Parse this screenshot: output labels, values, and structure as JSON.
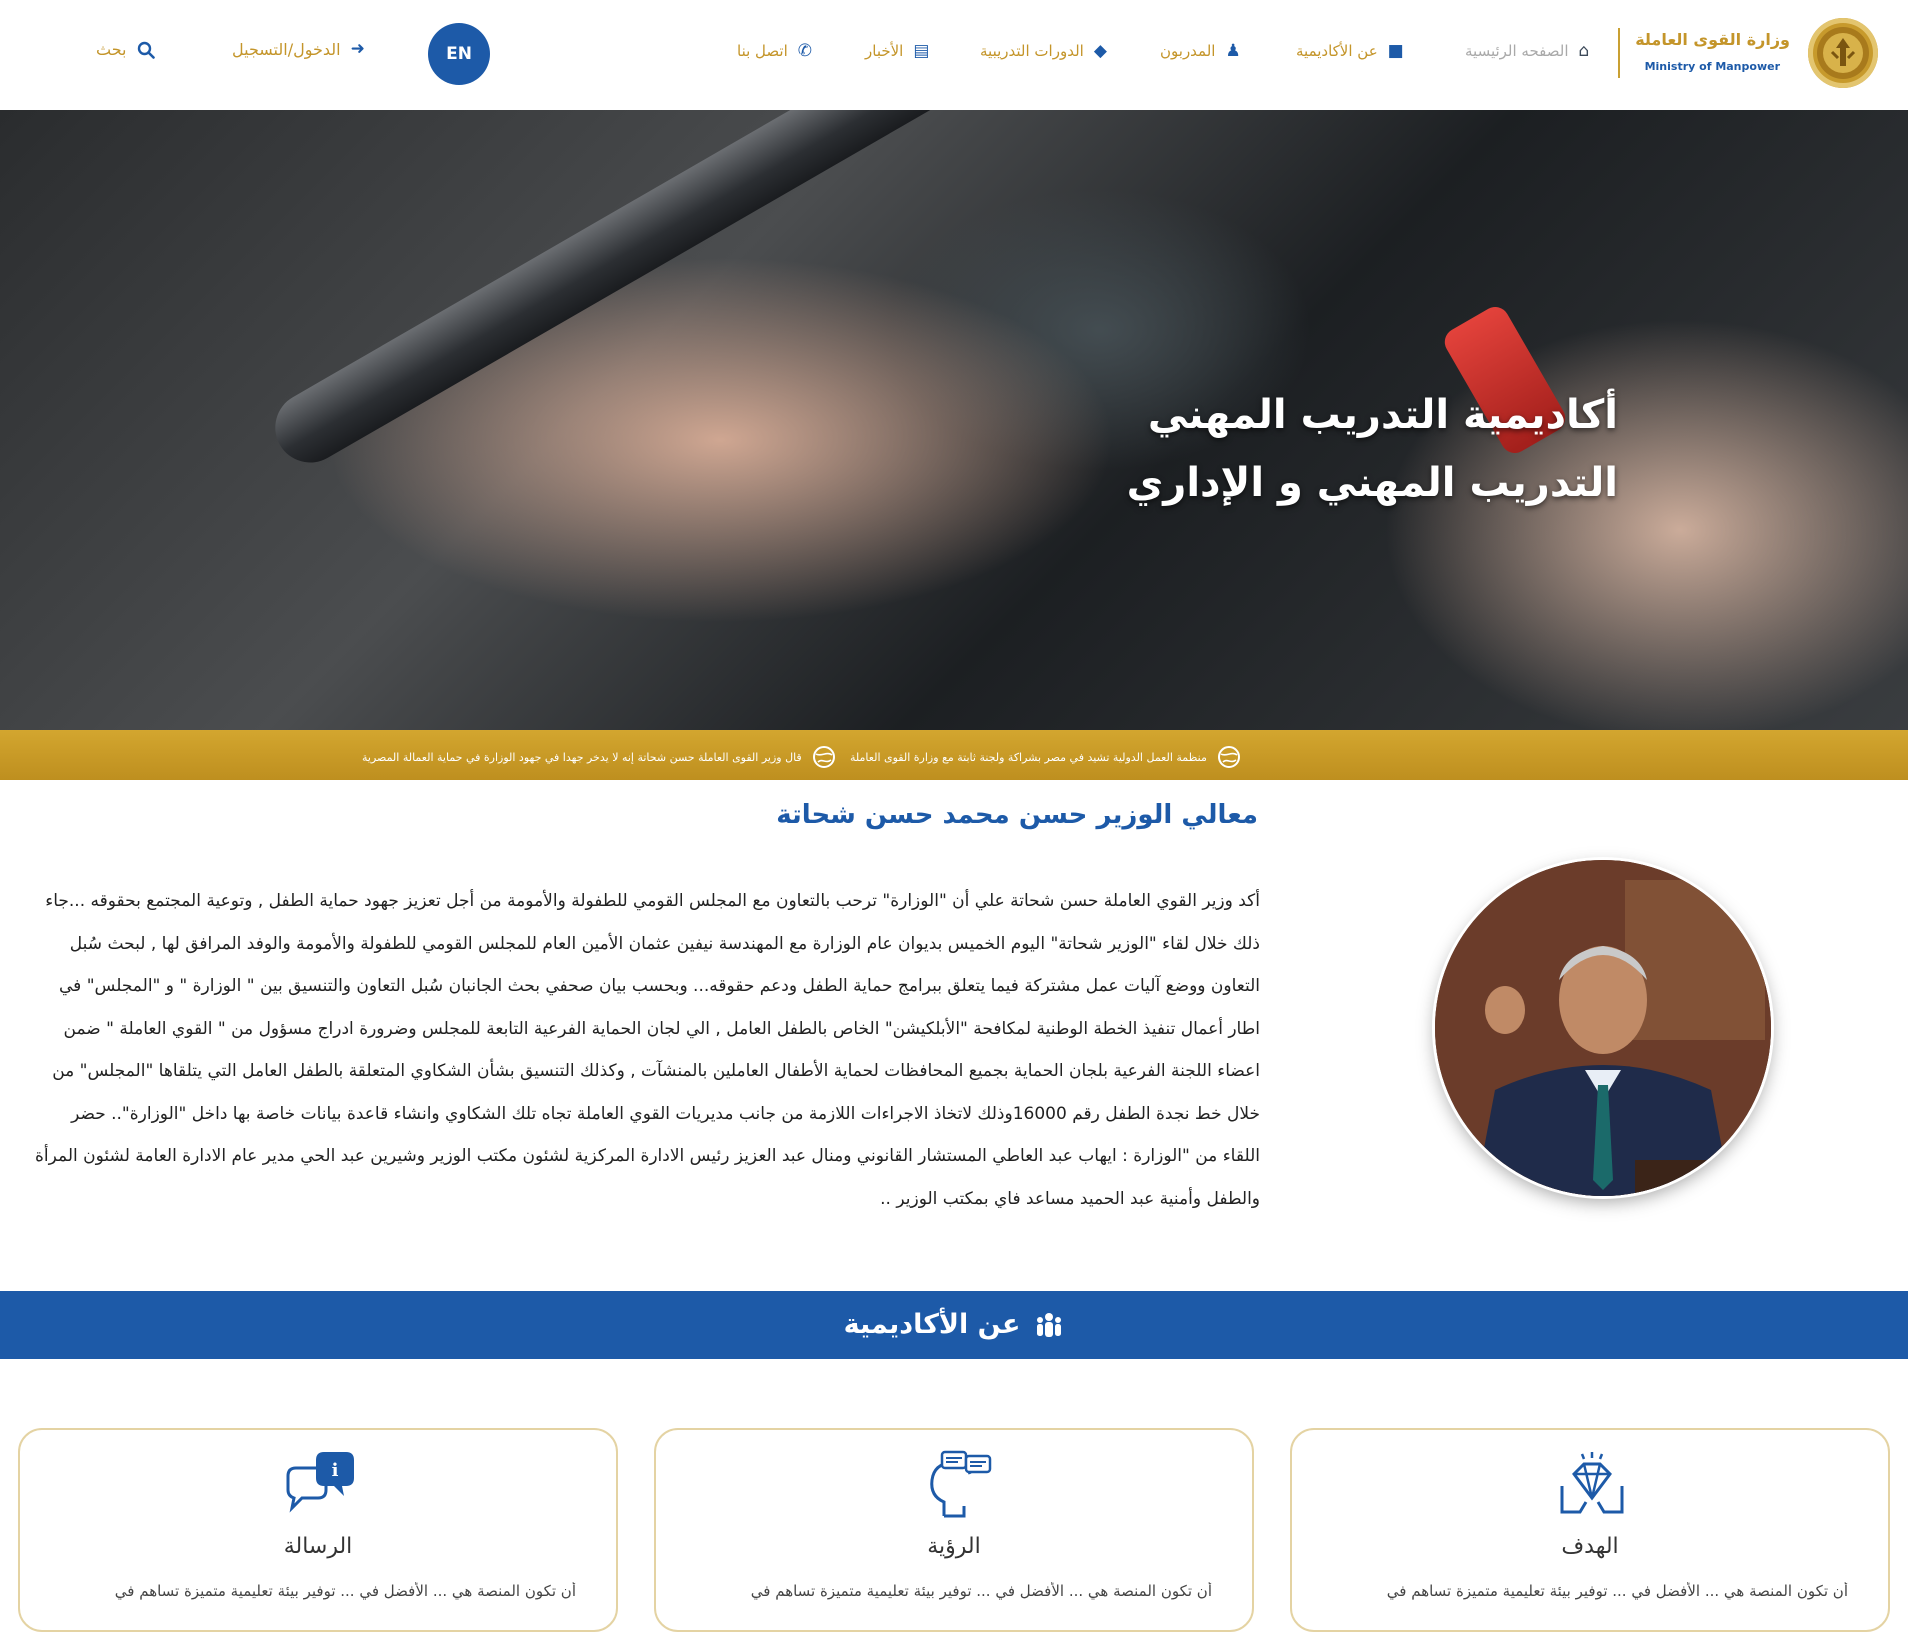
{
  "header": {
    "logo_ar": "وزارة القوى العاملة",
    "logo_en": "Ministry of Manpower",
    "nav": [
      {
        "label": "الصفحه الرئيسية",
        "icon": "home-icon"
      },
      {
        "label": "عن الأكاديمية",
        "icon": "bookmark-icon"
      },
      {
        "label": "المدربون",
        "icon": "trainer-icon"
      },
      {
        "label": "الدورات التدريبية",
        "icon": "graduation-cap-icon"
      },
      {
        "label": "الأخبار",
        "icon": "newspaper-icon"
      },
      {
        "label": "اتصل بنا",
        "icon": "phone-icon"
      }
    ],
    "lang_button": "EN",
    "login_label": "الدخول/التسجيل",
    "search_label": "بحث"
  },
  "hero": {
    "title_line1": "أكاديمية التدريب المهني",
    "title_line2": "التدريب المهني و الإداري"
  },
  "ticker": {
    "items": [
      "منظمة العمل الدولية تشيد في مصر بشراكة ولجنة ثابتة مع وزارة القوى العاملة",
      "قال وزير القوى العاملة حسن شحاتة إنه لا يدخر جهدا في جهود الوزارة في حماية العمالة المصرية"
    ]
  },
  "minister": {
    "title": "معالي الوزير حسن محمد حسن شحاتة",
    "body": "أكد وزير القوي العاملة حسن شحاتة علي أن \"الوزارة\" ترحب بالتعاون مع المجلس القومي للطفولة والأمومة من أجل تعزيز جهود حماية الطفل , وتوعية المجتمع بحقوقه ...جاء ذلك خلال لقاء \"الوزير شحاتة\" اليوم الخميس بديوان عام الوزارة مع المهندسة نيفين عثمان الأمين العام للمجلس القومي للطفولة والأمومة والوفد المرافق لها , لبحث سُبل التعاون ووضع آليات عمل مشتركة فيما يتعلق ببرامج حماية الطفل ودعم حقوقه... وبحسب بيان صحفي بحث الجانبان سُبل التعاون والتنسيق بين \" الوزارة \" و \"المجلس\" في اطار أعمال تنفيذ الخطة الوطنية لمكافحة \"الأبلكيشن\" الخاص بالطفل العامل , الي لجان الحماية الفرعية التابعة للمجلس وضرورة ادراج مسؤول من \" القوي العاملة \" ضمن اعضاء اللجنة الفرعية بلجان الحماية بجميع المحافظات لحماية الأطفال العاملين بالمنشآت , وكذلك التنسيق بشأن الشكاوي المتعلقة بالطفل العامل التي يتلقاها \"المجلس\" من خلال خط نجدة الطفل رقم 16000وذلك لاتخاذ الاجراءات اللازمة من جانب مديريات القوي العاملة تجاه تلك الشكاوي وانشاء قاعدة بيانات خاصة بها داخل \"الوزارة\".. حضر اللقاء من \"الوزارة : ايهاب عبد العاطي المستشار القانوني ومنال عبد العزيز رئيس الادارة المركزية لشئون مكتب الوزير وشيرين عبد الحي مدير عام الادارة العامة لشئون المرأة والطفل وأمنية عبد الحميد مساعد فاي بمكتب الوزير .."
  },
  "about": {
    "title": "عن الأكاديمية",
    "cards": [
      {
        "title": "الهدف",
        "icon": "diamond-hands-icon",
        "text": "أن تكون المنصة هي ... الأفضل في ... توفير بيئة تعليمية متميزة تساهم في"
      },
      {
        "title": "الرؤية",
        "icon": "vision-head-icon",
        "text": "أن تكون المنصة هي ... الأفضل في ... توفير بيئة تعليمية متميزة تساهم في"
      },
      {
        "title": "الرسالة",
        "icon": "message-bubbles-icon",
        "text": "أن تكون المنصة هي ... الأفضل في ... توفير بيئة تعليمية متميزة تساهم في"
      }
    ]
  },
  "colors": {
    "brand_blue": "#1d5aa8",
    "brand_gold": "#c4952a",
    "ticker_gold": "#c9a02a"
  }
}
